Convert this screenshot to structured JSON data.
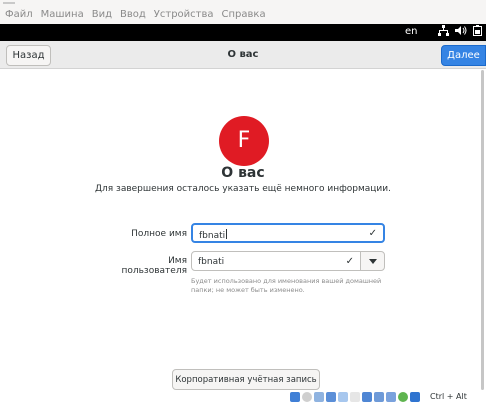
{
  "vbox_menu": [
    "Файл",
    "Машина",
    "Вид",
    "Ввод",
    "Устройства",
    "Справка"
  ],
  "topbar": {
    "language": "en",
    "icons": [
      "network-icon",
      "volume-icon",
      "battery-icon"
    ]
  },
  "header": {
    "back_label": "Назад",
    "title": "О вас",
    "next_label": "Далее"
  },
  "avatar": {
    "letter": "F",
    "color": "#e01b24"
  },
  "main": {
    "title": "О вас",
    "subtitle": "Для завершения осталось указать ещё немного информации."
  },
  "form": {
    "full_name_label": "Полное имя",
    "full_name_value": "fbnati",
    "username_label": "Имя пользователя",
    "username_value": "fbnati",
    "username_hint": "Будет использовано для именования вашей домашней папки; не может быть изменено."
  },
  "enterprise_button_label": "Корпоративная учётная запись",
  "statusbar": {
    "host_key": "Ctrl + Alt"
  },
  "colors": {
    "accent": "#3584e4",
    "avatar": "#e01b24",
    "topbar": "#000000"
  }
}
